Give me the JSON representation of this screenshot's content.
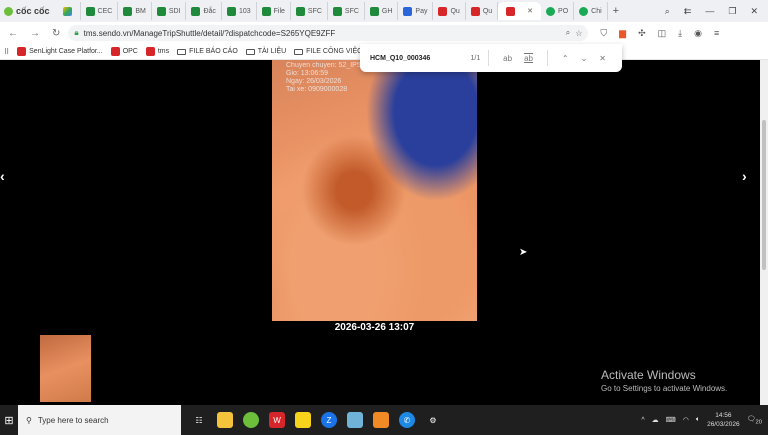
{
  "browser": {
    "name": "cốc cốc",
    "tabs": [
      {
        "label": "",
        "icon": "google-drive-icon"
      },
      {
        "label": "CEC",
        "icon": "sheets-icon"
      },
      {
        "label": "BM",
        "icon": "sheets-icon"
      },
      {
        "label": "SDI",
        "icon": "sheets-icon"
      },
      {
        "label": "Đắc",
        "icon": "sheets-icon"
      },
      {
        "label": "103",
        "icon": "sheets-icon"
      },
      {
        "label": "File",
        "icon": "sheets-icon"
      },
      {
        "label": "SFC",
        "icon": "sheets-icon"
      },
      {
        "label": "SFC",
        "icon": "sheets-icon"
      },
      {
        "label": "GH",
        "icon": "sheets-icon"
      },
      {
        "label": "Pay",
        "icon": "pay-icon"
      },
      {
        "label": "Qu",
        "icon": "sendo-icon"
      },
      {
        "label": "Qu",
        "icon": "sendo-icon"
      },
      {
        "label": "",
        "icon": "sendo-icon",
        "active": true
      },
      {
        "label": "PO",
        "icon": "s-icon"
      },
      {
        "label": "Chi",
        "icon": "s-icon"
      }
    ],
    "url": "tms.sendo.vn/ManageTripShuttle/detail/?dispatchcode=S265YQE9ZFF",
    "bookmarks": [
      {
        "label": "SenLight Case Platfor...",
        "type": "sendo"
      },
      {
        "label": "OPC",
        "type": "sendo"
      },
      {
        "label": "tms",
        "type": "sendo"
      },
      {
        "label": "FILE BÁO CÁO",
        "type": "folder"
      },
      {
        "label": "TÀI LIỆU",
        "type": "folder"
      },
      {
        "label": "FILE CÔNG VIỆC",
        "type": "folder"
      }
    ]
  },
  "find": {
    "query": "HCM_Q10_000346",
    "count": "1/1",
    "match_case": "ab",
    "whole_word": "ab"
  },
  "viewer": {
    "overlay": [
      "Chuyen chuyen: 52_IP59",
      "Gio: 13:06:59",
      "Ngay: 26/03/2026",
      "Tai xe: 0909000028"
    ],
    "timestamp": "2026-03-26 13:07",
    "prev": "‹",
    "next": "›"
  },
  "watermark": {
    "title": "Activate Windows",
    "subtitle": "Go to Settings to activate Windows."
  },
  "taskbar": {
    "search_placeholder": "Type here to search",
    "time": "14:56",
    "date": "26/03/2026",
    "notifications": "20"
  }
}
